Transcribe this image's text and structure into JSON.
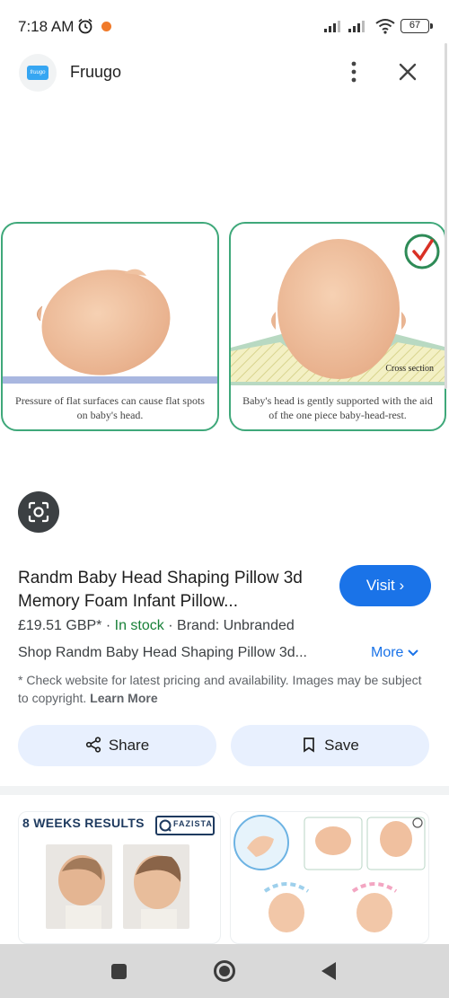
{
  "status_bar": {
    "time": "7:18 AM",
    "battery": "67",
    "icons": [
      "alarm-icon",
      "notification-dot",
      "signal-icon",
      "signal-icon",
      "wifi-icon",
      "battery-icon"
    ]
  },
  "header": {
    "site_name": "Fruugo",
    "logo_text": "fruugo",
    "icons": [
      "more-vert-icon",
      "close-icon"
    ]
  },
  "image": {
    "left_caption": "Pressure of flat surfaces can cause flat spots on baby's head.",
    "right_caption": "Baby's head is gently supported with the aid of the one piece baby-head-rest.",
    "cross_section_label": "Cross section"
  },
  "product": {
    "title": "Randm Baby Head Shaping Pillow 3d Memory Foam Infant Pillow...",
    "visit_label": "Visit",
    "price": "£19.51 GBP*",
    "stock": "In stock",
    "brand": "Brand: Unbranded",
    "shop_line": "Shop Randm Baby Head Shaping Pillow 3d...",
    "more_label": "More",
    "disclaimer": "* Check website for latest pricing and availability. Images may be subject to copyright.",
    "learn_more": "Learn More"
  },
  "actions": {
    "share_label": "Share",
    "save_label": "Save"
  },
  "related": {
    "first_title": "8 WEEKS RESULTS",
    "badge_text": "FAZISTA"
  },
  "colors": {
    "accent": "#1a73e8",
    "panel_border": "#3fa87a",
    "stock_green": "#188038",
    "chip_bg": "#e8f0fe"
  }
}
